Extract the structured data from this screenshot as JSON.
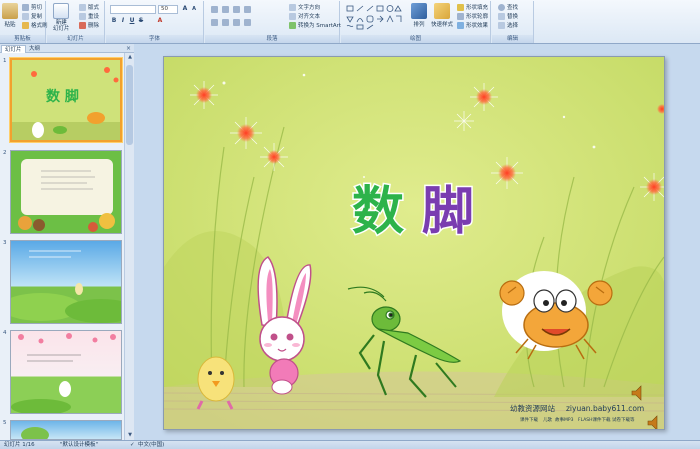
{
  "ribbon": {
    "clipboard": {
      "paste": "粘贴",
      "cut": "剪切",
      "copy": "复制",
      "format_painter": "格式刷",
      "label": "剪贴板"
    },
    "slides": {
      "new_slide": "新建\n幻灯片",
      "layout": "版式",
      "reset": "重设",
      "delete": "删除",
      "label": "幻灯片"
    },
    "font": {
      "font_value": "",
      "size_value": "50",
      "label": "字体"
    },
    "paragraph": {
      "text_direction": "文字方向",
      "align_text": "对齐文本",
      "smartart": "转换为 SmartArt",
      "label": "段落"
    },
    "drawing": {
      "arrange": "排列",
      "quick_styles": "快速样式",
      "shape_fill": "形状填充",
      "shape_outline": "形状轮廓",
      "shape_effects": "形状效果",
      "label": "绘图"
    },
    "editing": {
      "find": "查找",
      "replace": "替换",
      "select": "选择",
      "label": "编辑"
    }
  },
  "panel": {
    "tab_slides": "幻灯片",
    "tab_outline": "大纲",
    "close": "×",
    "thumbnails": [
      {
        "number": "1",
        "title": "数 脚"
      },
      {
        "number": "2"
      },
      {
        "number": "3"
      },
      {
        "number": "4"
      },
      {
        "number": "5"
      }
    ]
  },
  "slide": {
    "title_chars": [
      "数",
      "脚"
    ],
    "site_name": "幼教资源网站",
    "site_url": "ziyuan.baby611.com",
    "footer_links": [
      "课件下载",
      "儿歌",
      "故事MP3",
      "FLASH课件下载",
      "试卷下载等"
    ]
  },
  "status": {
    "slide_info": "幻灯片 1/16",
    "theme": "\"默认设计模板\"",
    "language": "中文(中国)"
  },
  "colors": {
    "slide_bg": "#cfe27a",
    "title_green": "#2db34a",
    "title_purple": "#7a3db0",
    "selection": "#f2a12e"
  }
}
